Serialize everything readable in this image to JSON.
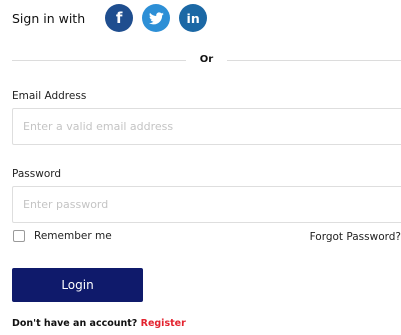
{
  "social": {
    "sign_in_text": "Sign in with",
    "buttons": [
      {
        "name": "facebook",
        "glyph": "f",
        "color": "#1f4e8f"
      },
      {
        "name": "twitter",
        "glyph": "t",
        "color": "#2d8fd6"
      },
      {
        "name": "linkedin",
        "glyph": "in",
        "color": "#1b68a5"
      }
    ]
  },
  "divider": {
    "text": "Or"
  },
  "email": {
    "label": "Email Address",
    "placeholder": "Enter a valid email address",
    "value": ""
  },
  "password": {
    "label": "Password",
    "placeholder": "Enter password",
    "value": ""
  },
  "remember": {
    "label": "Remember me",
    "checked": false
  },
  "forgot": {
    "label": "Forgot Password?"
  },
  "login": {
    "label": "Login",
    "color": "#0f1a6b"
  },
  "register": {
    "prompt": "Don't have an account?",
    "link_label": "Register",
    "link_color": "#e3232f"
  }
}
